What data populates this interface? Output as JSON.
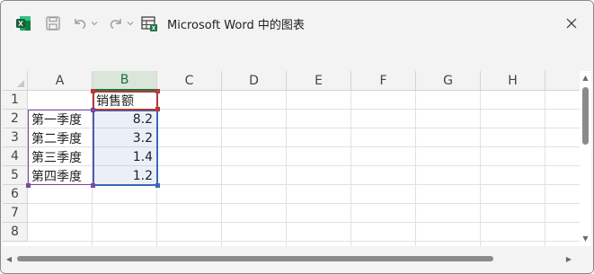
{
  "window": {
    "title": "Microsoft Word 中的图表",
    "close_label": "✕"
  },
  "toolbar": {
    "app_icon": "excel-icon",
    "save_icon": "save-icon",
    "undo_icon": "undo-icon",
    "redo_icon": "redo-icon",
    "chart_data_icon": "chart-data-icon"
  },
  "sheet": {
    "columns": [
      "A",
      "B",
      "C",
      "D",
      "E",
      "F",
      "G",
      "H"
    ],
    "selected_column": "B",
    "rows": [
      "1",
      "2",
      "3",
      "4",
      "5",
      "6",
      "7",
      "8"
    ],
    "cells": {
      "B1": "销售额",
      "A2": "第一季度",
      "B2": "8.2",
      "A3": "第二季度",
      "B3": "3.2",
      "A4": "第三季度",
      "B4": "1.4",
      "A5": "第四季度",
      "B5": "1.2"
    }
  },
  "colors": {
    "excel_green": "#217346",
    "series_range": "#7a4aa0",
    "values_range": "#3a67b8",
    "header_range": "#b23a3a"
  }
}
